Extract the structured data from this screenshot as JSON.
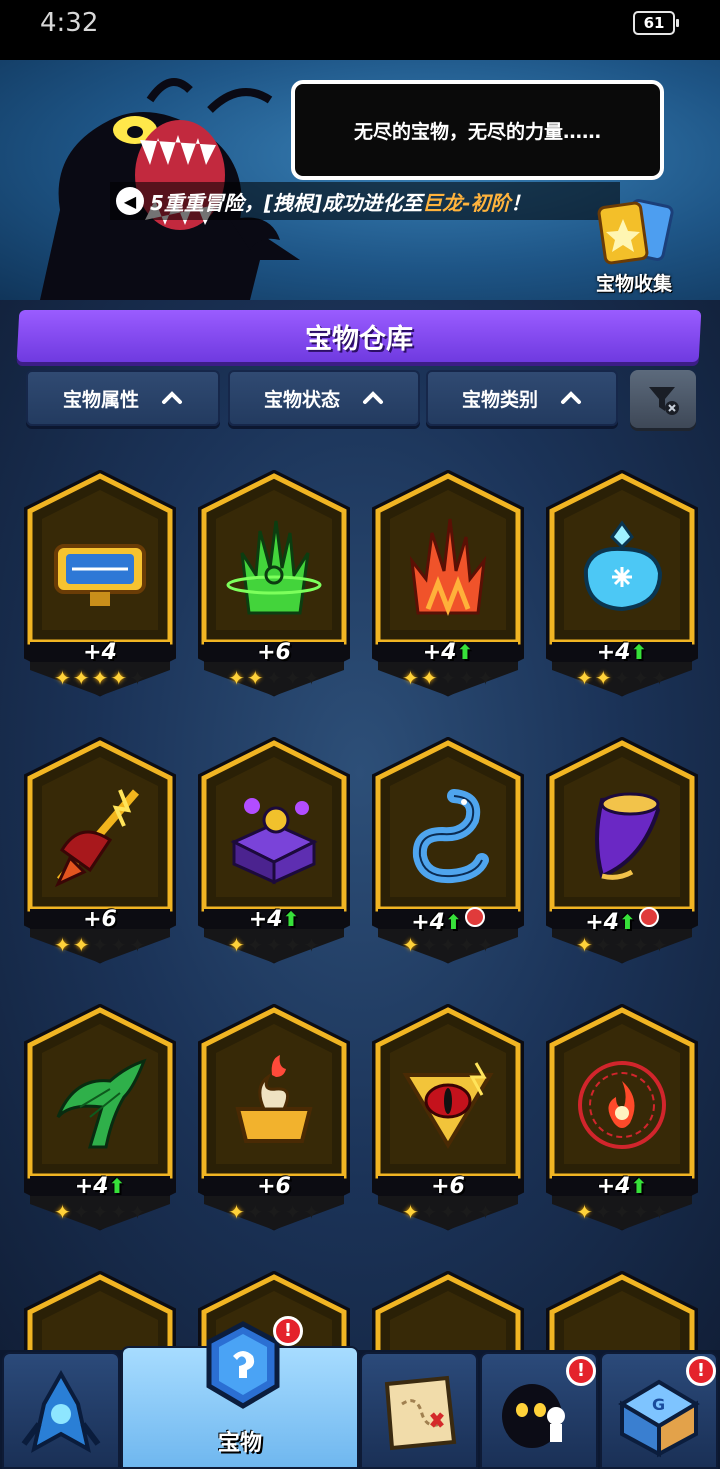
{
  "status": {
    "time": "4:32",
    "battery": "61"
  },
  "banner": {
    "speech": "无尽的宝物，无尽的力量……",
    "ticker_prefix": "5重重冒险，[拽根]成功进化至",
    "ticker_highlight": "巨龙-初阶",
    "ticker_suffix": "！",
    "collection_label": "宝物收集"
  },
  "title": "宝物仓库",
  "filters": [
    {
      "label": "宝物属性"
    },
    {
      "label": "宝物状态"
    },
    {
      "label": "宝物类别"
    }
  ],
  "cards": [
    {
      "name": "golden-plaque-treasure",
      "level": "+4",
      "up": false,
      "hot": false,
      "stars": 4,
      "art": "plaque"
    },
    {
      "name": "green-vortex-treasure",
      "level": "+6",
      "up": false,
      "hot": false,
      "stars": 2,
      "art": "greenflame"
    },
    {
      "name": "red-flame-treasure",
      "level": "+4",
      "up": true,
      "hot": false,
      "stars": 2,
      "art": "redflame"
    },
    {
      "name": "ice-bottle-treasure",
      "level": "+4",
      "up": true,
      "hot": false,
      "stars": 2,
      "art": "ice"
    },
    {
      "name": "thunder-spear-treasure",
      "level": "+6",
      "up": false,
      "hot": false,
      "stars": 2,
      "art": "spear"
    },
    {
      "name": "shadow-chest-treasure",
      "level": "+4",
      "up": true,
      "hot": false,
      "stars": 1,
      "art": "chest"
    },
    {
      "name": "ice-dragon-treasure",
      "level": "+4",
      "up": true,
      "hot": true,
      "stars": 1,
      "art": "dragon"
    },
    {
      "name": "purple-horn-treasure",
      "level": "+4",
      "up": true,
      "hot": true,
      "stars": 1,
      "art": "horn"
    },
    {
      "name": "green-wing-treasure",
      "level": "+4",
      "up": true,
      "hot": false,
      "stars": 1,
      "art": "wing"
    },
    {
      "name": "golden-bowl-treasure",
      "level": "+6",
      "up": false,
      "hot": false,
      "stars": 1,
      "art": "bowl"
    },
    {
      "name": "dragon-eye-treasure",
      "level": "+6",
      "up": false,
      "hot": false,
      "stars": 1,
      "art": "eye"
    },
    {
      "name": "fire-sigil-treasure",
      "level": "+4",
      "up": true,
      "hot": false,
      "stars": 1,
      "art": "sigil"
    }
  ],
  "nav": [
    {
      "name": "nav-tab-hero",
      "label": "",
      "badge": false
    },
    {
      "name": "nav-tab-treasure",
      "label": "宝物",
      "badge": true
    },
    {
      "name": "nav-tab-map",
      "label": "",
      "badge": false
    },
    {
      "name": "nav-tab-character",
      "label": "",
      "badge": true
    },
    {
      "name": "nav-tab-shop",
      "label": "",
      "badge": true
    }
  ],
  "badge_text": "!",
  "colors": {
    "accent": "#8a4dff",
    "frame_gold": "#f1b523",
    "upgrade_green": "#37e13a",
    "badge_red": "#e4222b"
  }
}
